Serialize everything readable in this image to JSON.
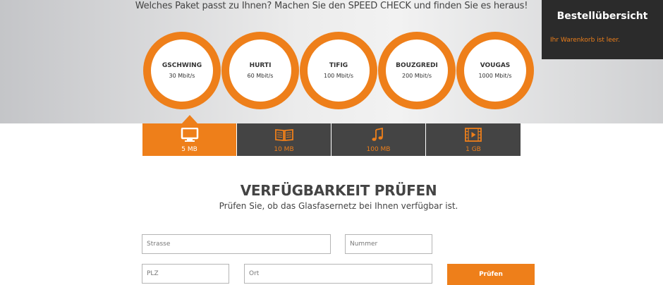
{
  "hero": {
    "intro": "Welches Paket passt zu Ihnen? Machen Sie den SPEED CHECK und finden Sie es heraus!",
    "packages": [
      {
        "name": "GSCHWING",
        "speed": "30 Mbit/s"
      },
      {
        "name": "HURTI",
        "speed": "60 Mbit/s"
      },
      {
        "name": "TIFIG",
        "speed": "100 Mbit/s"
      },
      {
        "name": "BOUZGREDI",
        "speed": "200 Mbit/s"
      },
      {
        "name": "VOUGAS",
        "speed": "1000 Mbit/s"
      }
    ]
  },
  "order": {
    "title": "Bestellübersicht",
    "empty_text": "Ihr Warenkorb ist leer."
  },
  "tabs": [
    {
      "label": "5 MB",
      "icon": "tv-icon",
      "active": true
    },
    {
      "label": "10 MB",
      "icon": "book-icon",
      "active": false
    },
    {
      "label": "100 MB",
      "icon": "music-note-icon",
      "active": false
    },
    {
      "label": "1 GB",
      "icon": "film-icon",
      "active": false
    }
  ],
  "availability": {
    "title": "VERFÜGBARKEIT PRÜFEN",
    "subtitle": "Prüfen Sie, ob das Glasfasernetz bei Ihnen verfügbar ist.",
    "street_placeholder": "Strasse",
    "number_placeholder": "Nummer",
    "zip_placeholder": "PLZ",
    "city_placeholder": "Ort",
    "submit_label": "Prüfen"
  },
  "colors": {
    "accent": "#ee7f1a",
    "dark": "#444444",
    "panel": "#2b2b2b"
  }
}
